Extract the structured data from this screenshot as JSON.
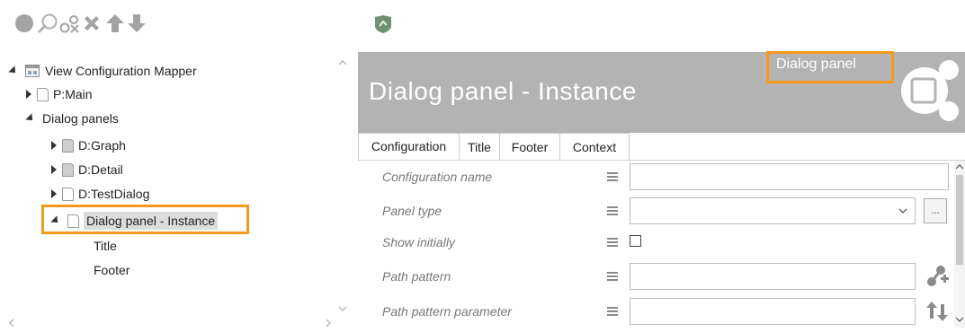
{
  "toolbar": {
    "icons": [
      "record-icon",
      "search-icon",
      "unlink-icon",
      "delete-icon",
      "move-up-icon",
      "move-down-icon"
    ]
  },
  "right_toolbar": {
    "icons": [
      "shield-icon"
    ]
  },
  "tree": {
    "root": "View Configuration Mapper",
    "items": [
      {
        "label": "P:Main"
      },
      {
        "label": "Dialog panels"
      },
      {
        "label": "D:Graph"
      },
      {
        "label": "D:Detail"
      },
      {
        "label": "D:TestDialog"
      },
      {
        "label": "Dialog panel - Instance"
      },
      {
        "label": "Title"
      },
      {
        "label": "Footer"
      }
    ]
  },
  "header": {
    "title": "Dialog panel - Instance",
    "badge": "Dialog panel"
  },
  "tabs": [
    "Configuration",
    "Title",
    "Footer",
    "Context"
  ],
  "form": {
    "rows": [
      {
        "label": "Configuration name",
        "value": ""
      },
      {
        "label": "Panel type",
        "value": "",
        "button": "..."
      },
      {
        "label": "Show initially",
        "checked": false
      },
      {
        "label": "Path pattern",
        "value": ""
      },
      {
        "label": "Path pattern parameter",
        "value": ""
      }
    ]
  },
  "colors": {
    "accent": "#f39a1e",
    "header_bg": "#b3b3b3",
    "icon_gray": "#a3a3a3",
    "icon_green": "#6f8f73"
  }
}
